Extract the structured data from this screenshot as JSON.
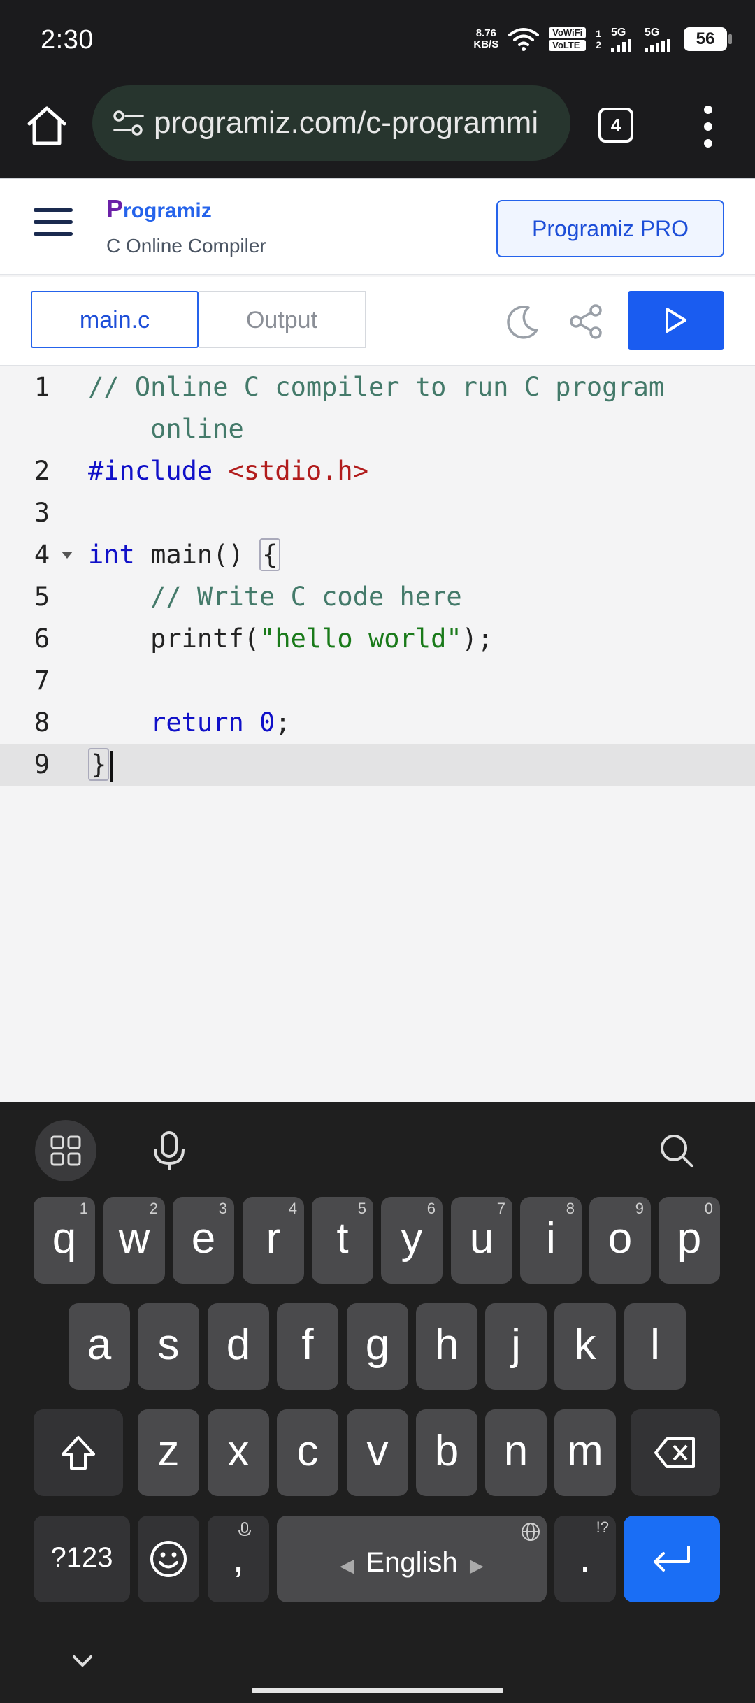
{
  "status_bar": {
    "time": "2:30",
    "net_speed_value": "8.76",
    "net_speed_unit": "KB/S",
    "vowifi": "VoWiFi",
    "volte": "VoLTE",
    "sim1": "1",
    "sim2": "2",
    "net1": "5G",
    "net2": "5G",
    "battery": "56"
  },
  "browser": {
    "url": "programiz.com/c-programmi",
    "tab_count": "4"
  },
  "site": {
    "logo": "Programiz",
    "logo_first": "P",
    "logo_rest": "rogramiz",
    "subtitle": "C Online Compiler",
    "pro_button": "Programiz PRO"
  },
  "toolbar": {
    "tabs": [
      {
        "label": "main.c",
        "active": true
      },
      {
        "label": "Output",
        "active": false
      }
    ]
  },
  "editor": {
    "line_numbers": [
      "1",
      "2",
      "3",
      "4",
      "5",
      "6",
      "7",
      "8",
      "9"
    ],
    "lines": {
      "l1a": "// Online C compiler to run C program",
      "l1b": "    online",
      "l2_directive": "#include",
      "l2_header": "<stdio.h>",
      "l4_kw": "int",
      "l4_rest": " main() ",
      "l4_brace": "{",
      "l5": "    // Write C code here",
      "l6_fn": "    printf(",
      "l6_str": "\"hello world\"",
      "l6_end": ");",
      "l8_kw": "    return",
      "l8_num": " 0",
      "l8_end": ";",
      "l9": "}"
    },
    "active_line": 9
  },
  "keyboard": {
    "row1": [
      {
        "k": "q",
        "h": "1"
      },
      {
        "k": "w",
        "h": "2"
      },
      {
        "k": "e",
        "h": "3"
      },
      {
        "k": "r",
        "h": "4"
      },
      {
        "k": "t",
        "h": "5"
      },
      {
        "k": "y",
        "h": "6"
      },
      {
        "k": "u",
        "h": "7"
      },
      {
        "k": "i",
        "h": "8"
      },
      {
        "k": "o",
        "h": "9"
      },
      {
        "k": "p",
        "h": "0"
      }
    ],
    "row2": [
      "a",
      "s",
      "d",
      "f",
      "g",
      "h",
      "j",
      "k",
      "l"
    ],
    "row3": [
      "z",
      "x",
      "c",
      "v",
      "b",
      "n",
      "m"
    ],
    "symbols_key": "?123",
    "comma_key": ",",
    "period_key": ".",
    "period_hint": "!?",
    "space_label": "English"
  }
}
